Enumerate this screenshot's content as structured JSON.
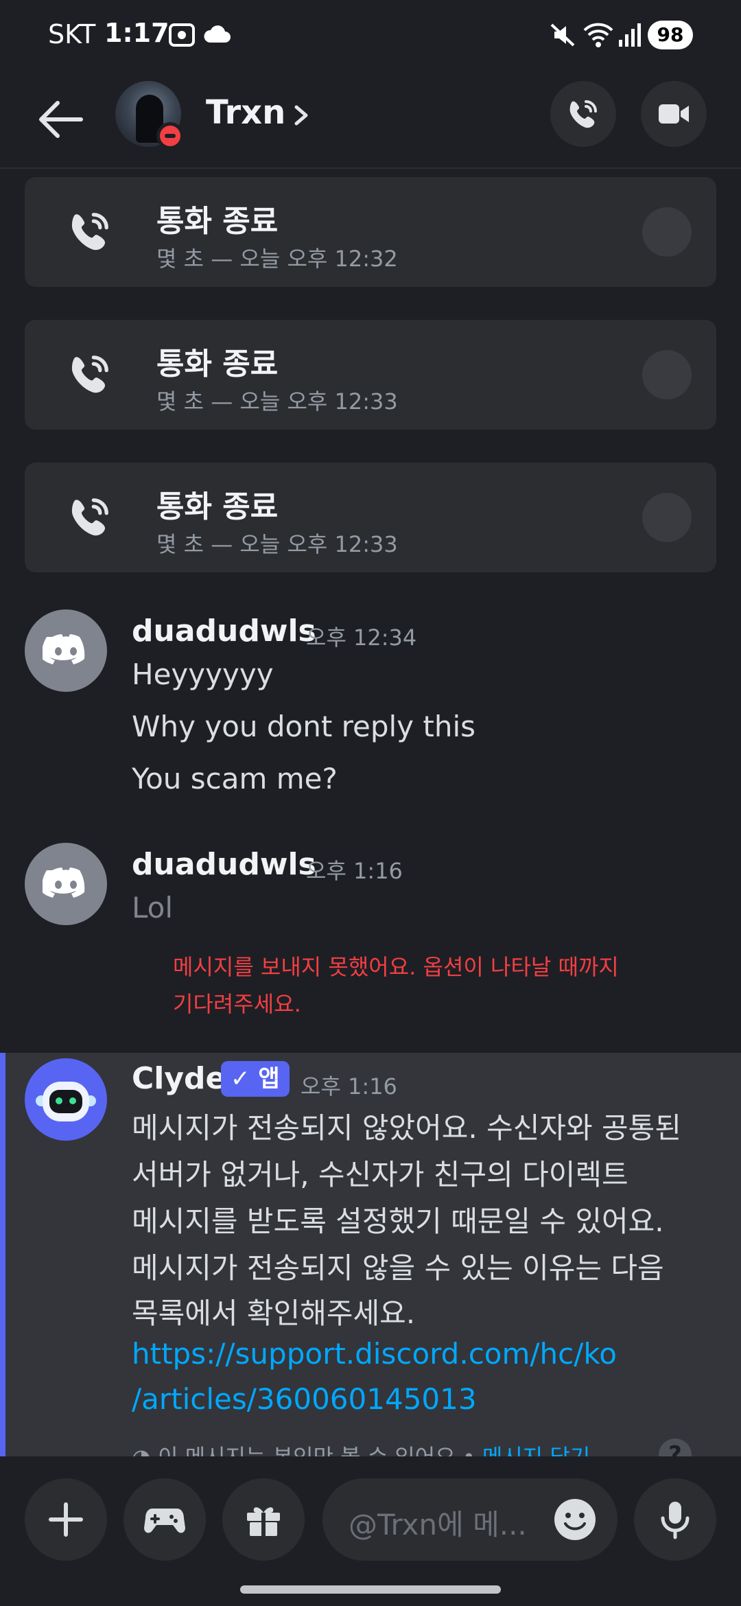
{
  "status_bar": {
    "carrier": "SKT",
    "time": "1:17",
    "battery": "98"
  },
  "header": {
    "name": "Trxn"
  },
  "calls": [
    {
      "title": "통화 종료",
      "subtitle": "몇 초 — 오늘 오후 12:32"
    },
    {
      "title": "통화 종료",
      "subtitle": "몇 초 — 오늘 오후 12:33"
    },
    {
      "title": "통화 종료",
      "subtitle": "몇 초 — 오늘 오후 12:33"
    }
  ],
  "messages": [
    {
      "user": "duadudwls",
      "time": "오후 12:34",
      "lines": [
        "Heyyyyyy",
        "Why you dont reply this",
        "You scam me?"
      ]
    },
    {
      "user": "duadudwls",
      "time": "오후 1:16",
      "lines": [
        "Lol"
      ],
      "error": [
        "메시지를 보내지 못했어요. 옵션이 나타날 때까지",
        "기다려주세요."
      ]
    }
  ],
  "clyde": {
    "name": "Clyde",
    "tag": "✓ 앱",
    "time": "오후 1:16",
    "lines": [
      "메시지가 전송되지 않았어요. 수신자와 공통된",
      "서버가 없거나, 수신자가 친구의 다이렉트",
      "메시지를 받도록 설정했기 때문일 수 있어요.",
      "메시지가 전송되지 않을 수 있는 이유는 다음",
      "목록에서 확인해주세요."
    ],
    "link_lines": [
      "https://support.discord.com/hc/ko",
      "/articles/360060145013"
    ],
    "notice": "이 메시지는 본인만 볼 수 있어요 •",
    "dismiss": "메시지 닫기",
    "help": "?"
  },
  "composer": {
    "placeholder": "@Trxn에 메..."
  },
  "colors": {
    "blurple": "#5865f2",
    "danger": "#f23f43",
    "link": "#00a8fc"
  }
}
